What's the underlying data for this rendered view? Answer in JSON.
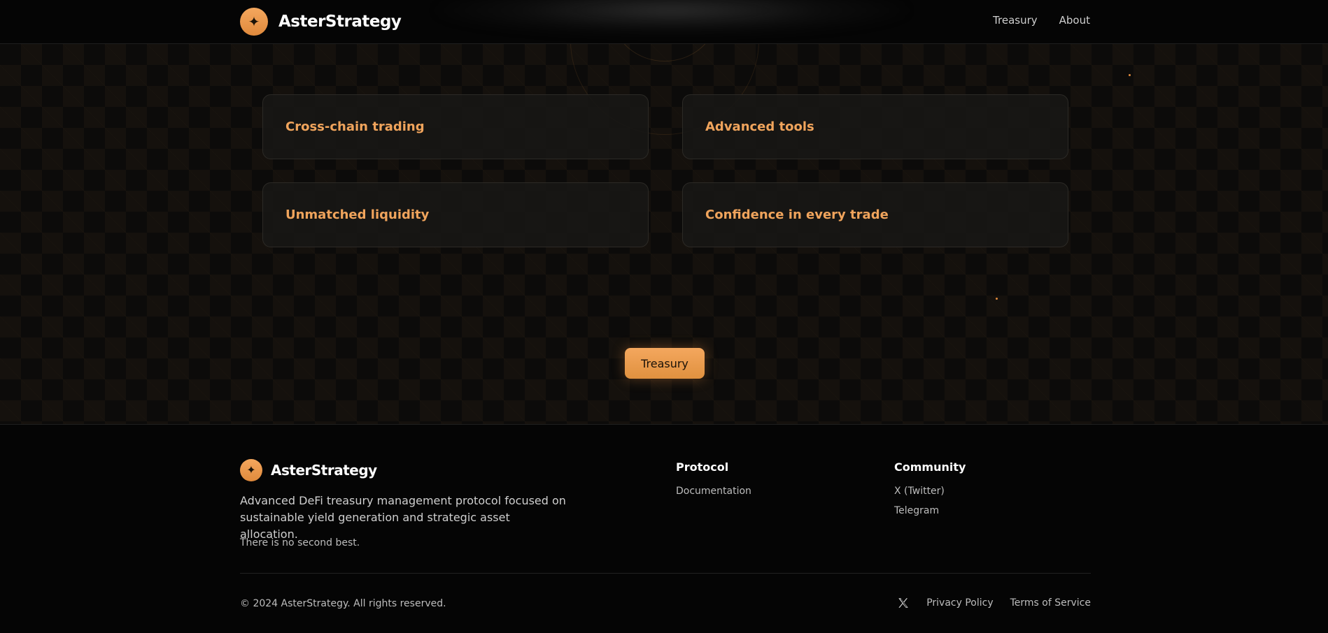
{
  "header": {
    "brand_name": "AsterStrategy",
    "logo_glyph": "✦",
    "nav": [
      {
        "label": "Treasury"
      },
      {
        "label": "About"
      }
    ]
  },
  "features": [
    {
      "title": "Cross-chain trading"
    },
    {
      "title": "Advanced tools"
    },
    {
      "title": "Unmatched liquidity"
    },
    {
      "title": "Confidence in every trade"
    }
  ],
  "cta": {
    "label": "Treasury"
  },
  "footer": {
    "brand_name": "AsterStrategy",
    "logo_glyph": "✦",
    "description": "Advanced DeFi treasury management protocol focused on sustainable yield generation and strategic asset allocation.",
    "tagline": "There is no second best.",
    "columns": [
      {
        "title": "Protocol",
        "links": [
          "Documentation"
        ]
      },
      {
        "title": "Community",
        "links": [
          "X (Twitter)",
          "Telegram"
        ]
      }
    ],
    "copyright": "© 2024 AsterStrategy. All rights reserved.",
    "bottom_links": [
      "Privacy Policy",
      "Terms of Service"
    ],
    "social_icon": "x-logo-icon"
  },
  "colors": {
    "accent": "#f0a45c",
    "background": "#0a0a0a"
  }
}
